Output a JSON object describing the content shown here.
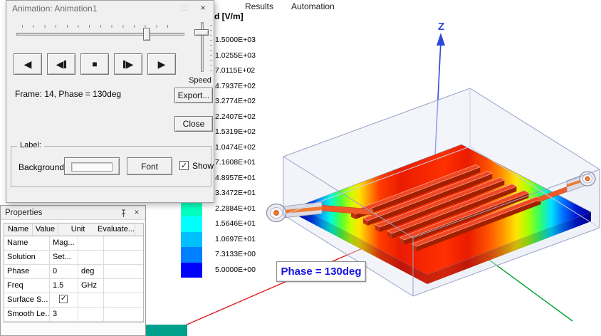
{
  "menu_bar": {
    "items": [
      {
        "label": "Results"
      },
      {
        "label": "Automation"
      }
    ]
  },
  "animation_dialog": {
    "title": "Animation: Animation1",
    "frame_info": "Frame: 14, Phase = 130deg",
    "speed_label": "Speed",
    "export_label": "Export...",
    "close_label": "Close",
    "label_group": {
      "legend": "Label:",
      "background_label": "Background:",
      "font_label": "Font",
      "show_label": "Show",
      "show_checked": true
    }
  },
  "properties_panel": {
    "title": "Properties",
    "columns": [
      "Name",
      "Value",
      "Unit",
      "Evaluate..."
    ],
    "rows": [
      {
        "name": "Name",
        "value": "Mag...",
        "unit": "",
        "checkbox": false,
        "check_glyph": ""
      },
      {
        "name": "Solution",
        "value": "Set...",
        "unit": "",
        "checkbox": false,
        "check_glyph": ""
      },
      {
        "name": "Phase",
        "value": "0",
        "unit": "deg",
        "checkbox": false,
        "check_glyph": ""
      },
      {
        "name": "Freq",
        "value": "1.5",
        "unit": "GHz",
        "checkbox": false,
        "check_glyph": ""
      },
      {
        "name": "Surface S...",
        "value": "",
        "unit": "",
        "checkbox": true,
        "check_glyph": "✓"
      },
      {
        "name": "Smooth Le...",
        "value": "3",
        "unit": "",
        "checkbox": false,
        "check_glyph": ""
      }
    ]
  },
  "legend": {
    "title": "d [V/m]",
    "entries": [
      {
        "label": "1.5000E+03",
        "color": "#ff0000"
      },
      {
        "label": "1.0255E+03",
        "color": "#ff4000"
      },
      {
        "label": "7.0115E+02",
        "color": "#ff8000"
      },
      {
        "label": "4.7937E+02",
        "color": "#ffbf00"
      },
      {
        "label": "3.2774E+02",
        "color": "#ffff00"
      },
      {
        "label": "2.2407E+02",
        "color": "#bfff00"
      },
      {
        "label": "1.5319E+02",
        "color": "#80ff00"
      },
      {
        "label": "1.0474E+02",
        "color": "#40ff00"
      },
      {
        "label": "7.1608E+01",
        "color": "#00ff00"
      },
      {
        "label": "4.8957E+01",
        "color": "#00ff40"
      },
      {
        "label": "3.3472E+01",
        "color": "#00ff80"
      },
      {
        "label": "2.2884E+01",
        "color": "#00ffbf"
      },
      {
        "label": "1.5646E+01",
        "color": "#00ffff"
      },
      {
        "label": "1.0697E+01",
        "color": "#00bfff"
      },
      {
        "label": "7.3133E+00",
        "color": "#0080ff"
      },
      {
        "label": "5.0000E+00",
        "color": "#0000ff"
      }
    ]
  },
  "viewport": {
    "phase_label": "Phase = 130deg",
    "z_axis_label": "Z",
    "axis_colors": {
      "x": "#e21b1b",
      "y": "#00a32e",
      "z": "#2a49d8"
    }
  },
  "icons": {
    "play_reverse": "◀",
    "play_forward": "▶",
    "stop": "■",
    "maximize": "□",
    "close": "×",
    "check": "✓"
  }
}
